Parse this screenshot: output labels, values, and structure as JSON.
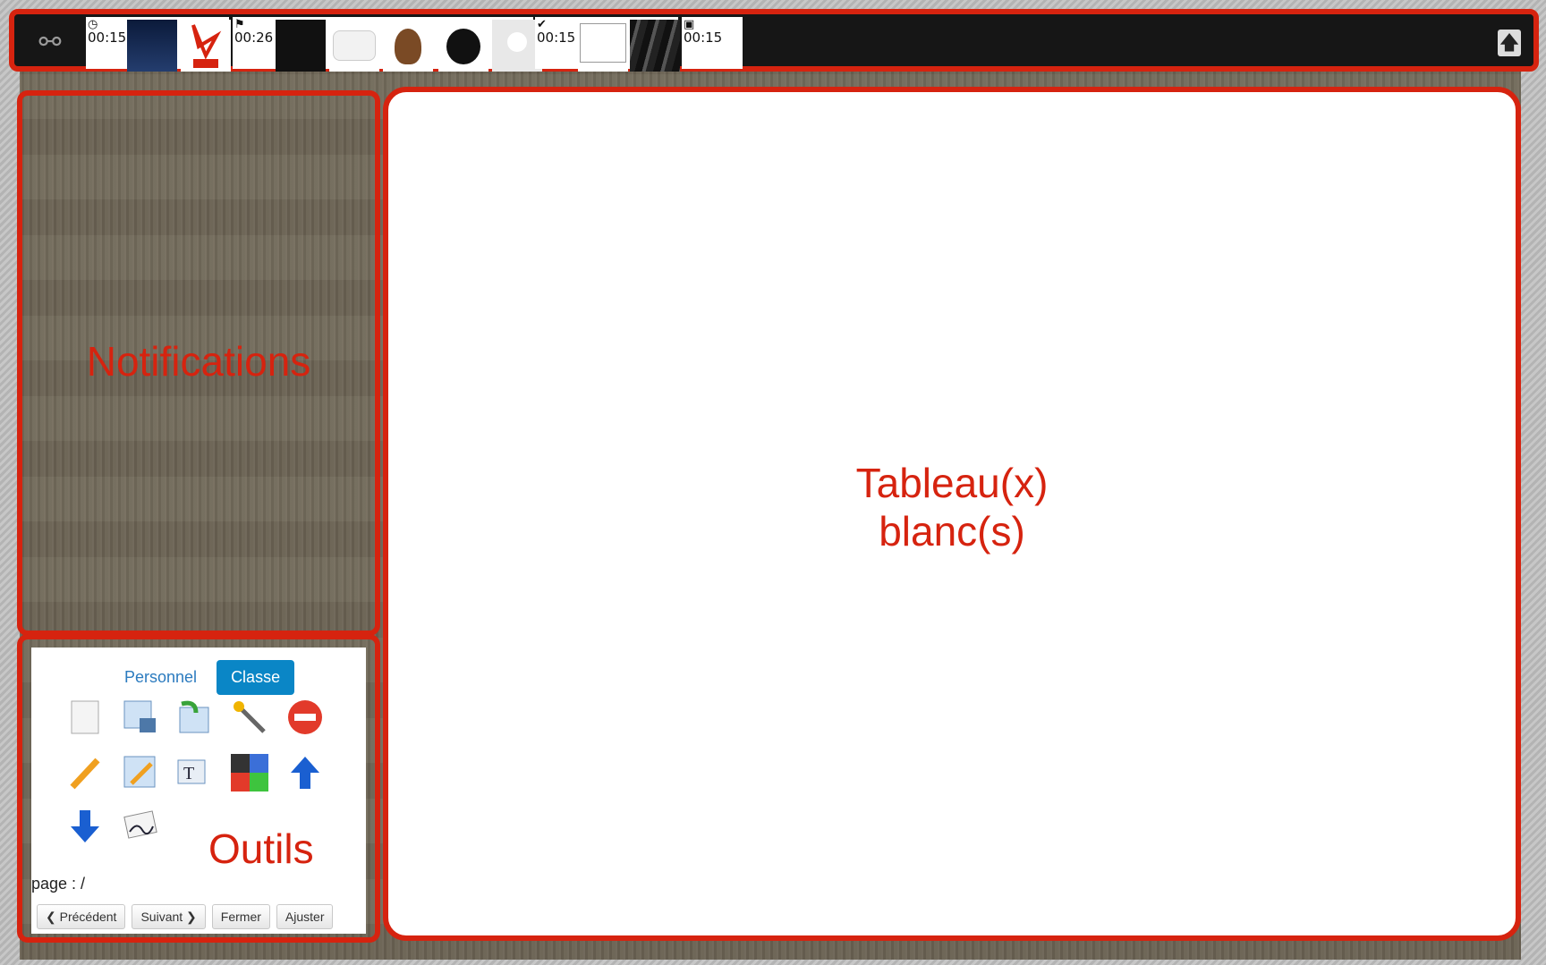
{
  "topbar": {
    "timeline": [
      {
        "time": "00:15",
        "icon": "play-circle-icon"
      },
      {
        "time": "00:26",
        "icon": "flag-icon"
      },
      {
        "time": "00:15",
        "icon": "check-circle-icon"
      },
      {
        "time": "00:15",
        "icon": "image-icon"
      }
    ],
    "thumbnails": [
      "video-thumbnail",
      "pdf-icon",
      "video-thumbnail-2",
      "google-maps-icon",
      "avatar-girl",
      "penguin-avatar",
      "default-avatar",
      "speech-bubble",
      "film-strip"
    ]
  },
  "annotations": {
    "notifications": "Notifications",
    "board_line1": "Tableau(x)",
    "board_line2": "blanc(s)",
    "tools": "Outils"
  },
  "tools": {
    "tabs": [
      "Personnel",
      "Classe"
    ],
    "active_tab": "Classe",
    "page_label": "page : /",
    "buttons": {
      "prev": "Précédent",
      "next": "Suivant",
      "close": "Fermer",
      "fit": "Ajuster"
    }
  },
  "colors": {
    "annotation": "#d6230f",
    "accent": "#0a86c6"
  }
}
